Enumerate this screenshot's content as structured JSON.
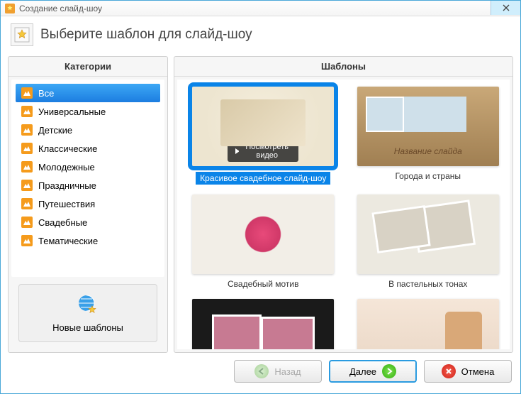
{
  "window": {
    "title": "Создание слайд-шоу"
  },
  "header": {
    "title": "Выберите шаблон для слайд-шоу"
  },
  "sidebar": {
    "header": "Категории",
    "items": [
      {
        "label": "Все",
        "selected": true
      },
      {
        "label": "Универсальные"
      },
      {
        "label": "Детские"
      },
      {
        "label": "Классические"
      },
      {
        "label": "Молодежные"
      },
      {
        "label": "Праздничные"
      },
      {
        "label": "Путешествия"
      },
      {
        "label": "Свадебные"
      },
      {
        "label": "Тематические"
      }
    ],
    "new_templates": "Новые шаблоны"
  },
  "templates": {
    "header": "Шаблоны",
    "watch_video": "Посмотреть видео",
    "items": [
      {
        "label": "Красивое свадебное слайд-шоу",
        "selected": true,
        "thumb_caption": ""
      },
      {
        "label": "Города и страны",
        "thumb_caption": "Название слайда"
      },
      {
        "label": "Свадебный мотив"
      },
      {
        "label": "В пастельных тонах"
      },
      {
        "label": ""
      },
      {
        "label": ""
      }
    ]
  },
  "footer": {
    "back": "Назад",
    "next": "Далее",
    "cancel": "Отмена"
  }
}
